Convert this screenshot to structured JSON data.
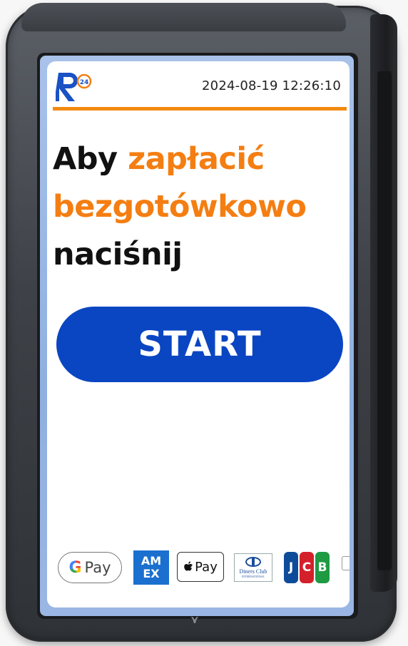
{
  "header": {
    "logo_text": "R",
    "logo_badge": "24",
    "timestamp": "2024-08-19 12:26:10"
  },
  "headline": {
    "word1": "Aby",
    "word2": "zapłacić",
    "word3": "bezgotówkowo",
    "word4": "naciśnij"
  },
  "start_button": {
    "label": "START"
  },
  "payment_methods": {
    "google_pay": "Pay",
    "google_g": "G",
    "amex_line1": "AM",
    "amex_line2": "EX",
    "apple_pay": "Pay",
    "diners_line1": "Diners Club",
    "diners_line2": "INTERNATIONAL",
    "jcb_j": "J",
    "jcb_c": "C",
    "jcb_b": "B"
  },
  "colors": {
    "accent_orange": "#f47e12",
    "button_blue": "#0a46c2",
    "logo_blue": "#1a52c4"
  }
}
